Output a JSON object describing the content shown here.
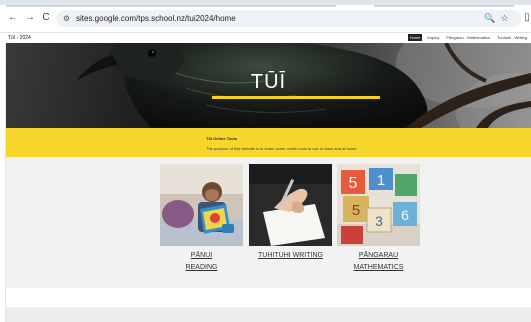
{
  "browser": {
    "url": "sites.google.com/tps.school.nz/tui2024/home",
    "back_icon": "←",
    "forward_icon": "→",
    "reload_icon": "C",
    "site_info_icon": "⚙",
    "zoom_icon": "🔍",
    "star_icon": "☆"
  },
  "site": {
    "title": "Tūī - 2024",
    "nav": [
      "Home",
      "Inquiry",
      "Pāngarau - Mathematics",
      "Tuhituhi - Writing"
    ]
  },
  "hero": {
    "title": "TŪĪ"
  },
  "band": {
    "title": "Tūī Online Tools",
    "text": "The purpose of this website is to share some online tools to use in class and at home."
  },
  "cards": [
    {
      "label_line1": "PĀNUI",
      "label_line2": "READING"
    },
    {
      "label_line1": "TUHITUHI WRITING",
      "label_line2": ""
    },
    {
      "label_line1": "PĀNGARAU",
      "label_line2": "MATHEMATICS"
    }
  ],
  "colors": {
    "accent_yellow": "#f7d72e",
    "nav_active": "#222222"
  }
}
